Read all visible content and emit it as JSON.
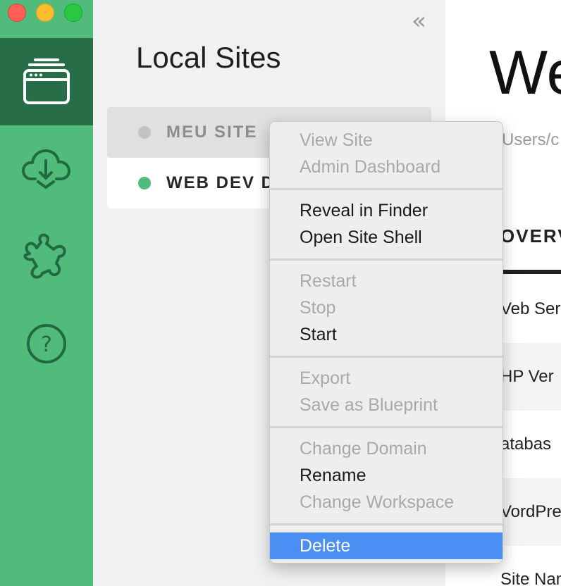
{
  "window": {
    "controls": [
      "close",
      "minimize",
      "zoom"
    ]
  },
  "rail": {
    "items": [
      {
        "icon": "sites-icon",
        "active": true
      },
      {
        "icon": "cloud-download-icon",
        "active": false
      },
      {
        "icon": "puzzle-addons-icon",
        "active": false
      },
      {
        "icon": "help-icon",
        "active": false
      }
    ],
    "help_glyph": "?"
  },
  "panel": {
    "collapse_glyph": "«",
    "title": "Local Sites",
    "sites": [
      {
        "name": "MEU SITE",
        "status": "stopped",
        "selected": true
      },
      {
        "name": "WEB DEV D",
        "status": "running",
        "selected": false
      }
    ]
  },
  "main": {
    "title": "We",
    "path": "Users/c",
    "tab": "OVERV",
    "rows": [
      "Veb Ser",
      "HP Ver",
      "atabas",
      "VordPre",
      "Site Nam"
    ]
  },
  "context_menu": {
    "groups": [
      [
        {
          "label": "View Site",
          "enabled": false
        },
        {
          "label": "Admin Dashboard",
          "enabled": false
        }
      ],
      [
        {
          "label": "Reveal in Finder",
          "enabled": true
        },
        {
          "label": "Open Site Shell",
          "enabled": true
        }
      ],
      [
        {
          "label": "Restart",
          "enabled": false
        },
        {
          "label": "Stop",
          "enabled": false
        },
        {
          "label": "Start",
          "enabled": true
        }
      ],
      [
        {
          "label": "Export",
          "enabled": false
        },
        {
          "label": "Save as Blueprint",
          "enabled": false
        }
      ],
      [
        {
          "label": "Change Domain",
          "enabled": false
        },
        {
          "label": "Rename",
          "enabled": true
        },
        {
          "label": "Change Workspace",
          "enabled": false
        }
      ],
      [
        {
          "label": "Delete",
          "enabled": true,
          "highlighted": true
        }
      ]
    ]
  },
  "colors": {
    "rail_green": "#51bb7b",
    "rail_active": "#276e48",
    "status_running": "#51bb7b",
    "status_stopped": "#c2c2c2",
    "menu_highlight": "#4b8ff5"
  }
}
